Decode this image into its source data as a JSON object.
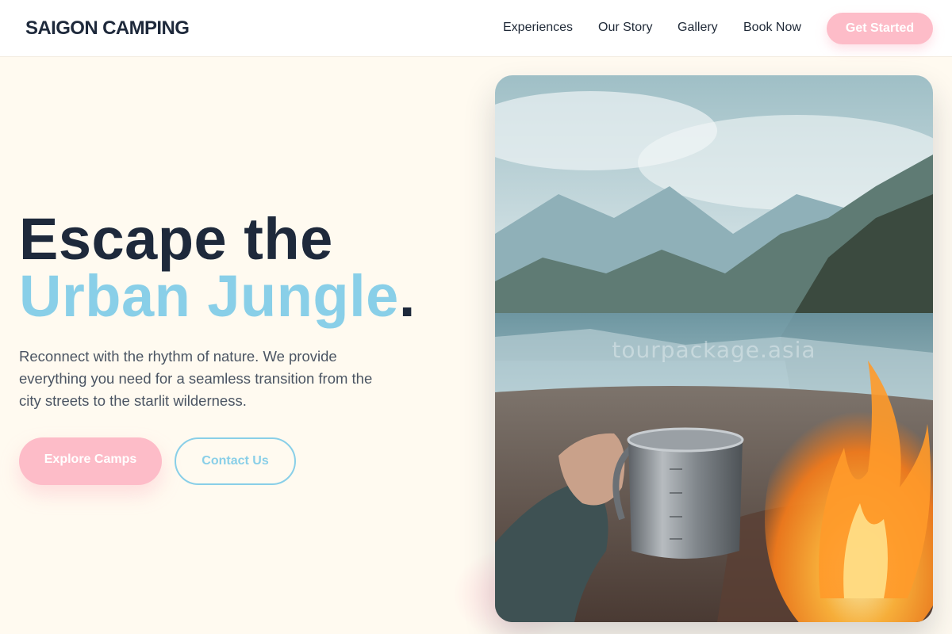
{
  "brand": {
    "name": "SAIGON CAMPING"
  },
  "nav": {
    "links": [
      {
        "label": "Experiences"
      },
      {
        "label": "Our Story"
      },
      {
        "label": "Gallery"
      },
      {
        "label": "Book Now"
      }
    ],
    "cta_label": "Get Started"
  },
  "hero": {
    "title_line1": "Escape the",
    "title_line2": "Urban Jungle",
    "title_period": ".",
    "description": "Reconnect with the rhythm of nature. We provide everything you need for a seamless transition from the city streets to the starlit wilderness.",
    "primary_button": "Explore Camps",
    "secondary_button": "Contact Us",
    "image_watermark": "tourpackage.asia"
  },
  "colors": {
    "accent_pink": "#fdbcc8",
    "accent_blue": "#89cfe8",
    "text_dark": "#1e293b",
    "background": "#fffaf0"
  },
  "icons": {
    "hero_image": "campfire-mug-photo"
  }
}
